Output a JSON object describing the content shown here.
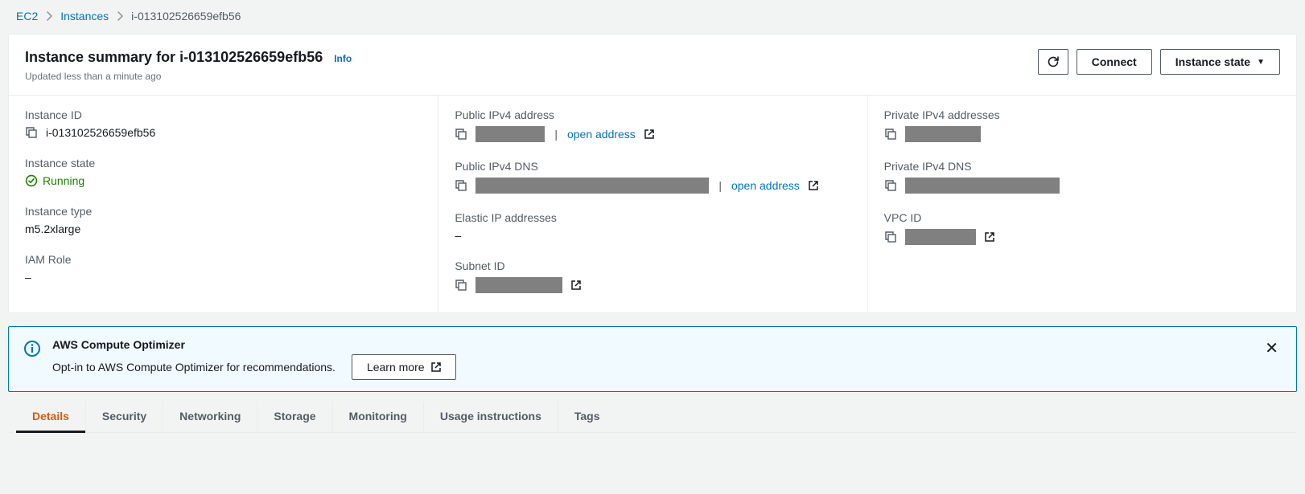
{
  "breadcrumb": {
    "root": "EC2",
    "section": "Instances",
    "current": "i-013102526659efb56"
  },
  "header": {
    "title": "Instance summary for i-013102526659efb56",
    "info": "Info",
    "subtitle": "Updated less than a minute ago",
    "connect": "Connect",
    "state_btn": "Instance state"
  },
  "fields": {
    "instance_id": {
      "label": "Instance ID",
      "value": "i-013102526659efb56"
    },
    "instance_state": {
      "label": "Instance state",
      "value": "Running"
    },
    "instance_type": {
      "label": "Instance type",
      "value": "m5.2xlarge"
    },
    "iam_role": {
      "label": "IAM Role",
      "value": "–"
    },
    "public_ipv4": {
      "label": "Public IPv4 address",
      "open": "open address"
    },
    "public_dns": {
      "label": "Public IPv4 DNS",
      "open": "open address"
    },
    "elastic_ip": {
      "label": "Elastic IP addresses",
      "value": "–"
    },
    "subnet_id": {
      "label": "Subnet ID"
    },
    "private_ipv4": {
      "label": "Private IPv4 addresses"
    },
    "private_dns": {
      "label": "Private IPv4 DNS"
    },
    "vpc_id": {
      "label": "VPC ID"
    }
  },
  "notice": {
    "title": "AWS Compute Optimizer",
    "text": "Opt-in to AWS Compute Optimizer for recommendations.",
    "learn_more": "Learn more"
  },
  "tabs": {
    "details": "Details",
    "security": "Security",
    "networking": "Networking",
    "storage": "Storage",
    "monitoring": "Monitoring",
    "usage": "Usage instructions",
    "tags": "Tags"
  }
}
